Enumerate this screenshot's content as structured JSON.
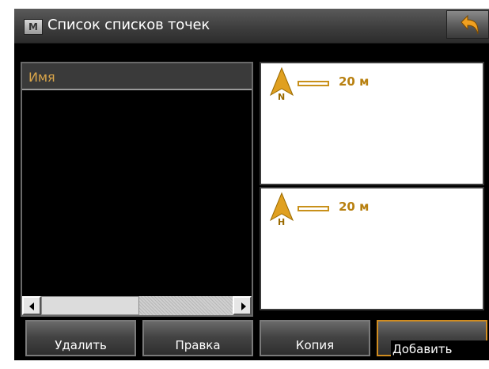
{
  "titlebar": {
    "menu_label": "M",
    "title": "Список списков точек"
  },
  "list": {
    "column_header": "Имя"
  },
  "maps": [
    {
      "scale": "20 м",
      "compass_letter": "N"
    },
    {
      "scale": "20 м",
      "compass_letter": "H"
    }
  ],
  "buttons": {
    "delete": "Удалить",
    "edit": "Правка",
    "copy": "Копия",
    "add": "Добавить"
  },
  "colors": {
    "accent": "#d9a54a",
    "compass": "#e0a020",
    "scale": "#b88010",
    "selected_border": "#d08c20"
  }
}
